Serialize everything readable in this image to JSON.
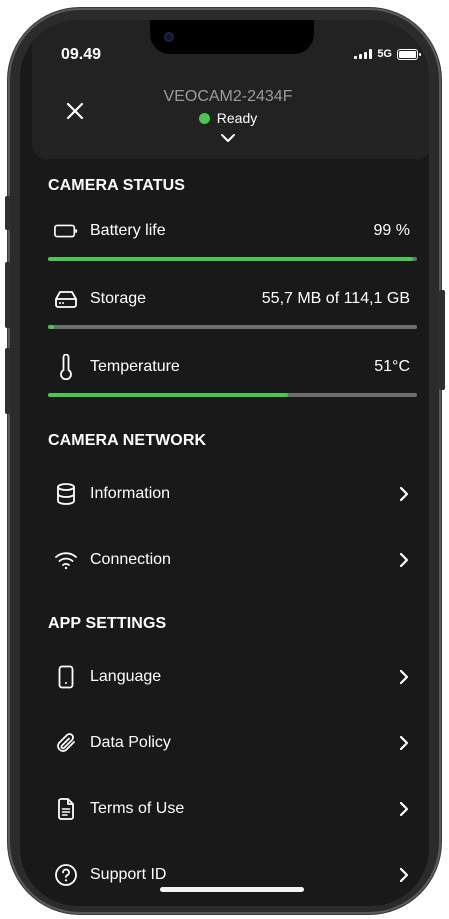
{
  "status_bar": {
    "time": "09.49",
    "network": "5G"
  },
  "header": {
    "device_name": "VEOCAM2-2434F",
    "status_text": "Ready",
    "status_color": "#4cc552"
  },
  "camera_status": {
    "title": "CAMERA STATUS",
    "battery": {
      "label": "Battery life",
      "value": "99 %",
      "progress": 0.99
    },
    "storage": {
      "label": "Storage",
      "value": "55,7 MB of 114,1 GB",
      "progress": 0.0005
    },
    "temperature": {
      "label": "Temperature",
      "value": "51°C",
      "progress": 0.65
    }
  },
  "camera_network": {
    "title": "CAMERA NETWORK",
    "items": [
      {
        "label": "Information",
        "icon": "database-icon"
      },
      {
        "label": "Connection",
        "icon": "wifi-icon"
      }
    ]
  },
  "app_settings": {
    "title": "APP SETTINGS",
    "items": [
      {
        "label": "Language",
        "icon": "phone-icon"
      },
      {
        "label": "Data Policy",
        "icon": "paperclip-icon"
      },
      {
        "label": "Terms of Use",
        "icon": "document-icon"
      },
      {
        "label": "Support ID",
        "icon": "help-circle-icon"
      }
    ]
  },
  "colors": {
    "accent": "#4cc552",
    "background": "#191919",
    "header": "#222222",
    "track": "#6e6e6e"
  }
}
